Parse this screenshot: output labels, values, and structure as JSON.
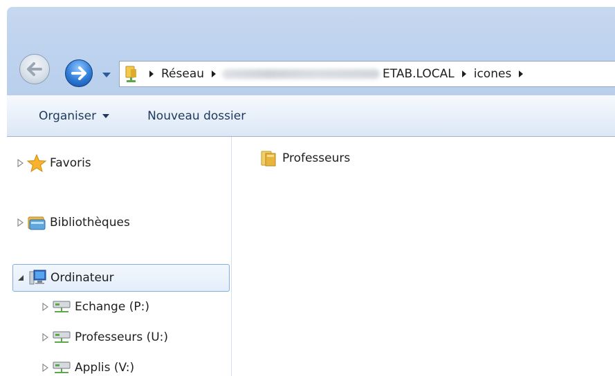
{
  "address_bar": {
    "crumbs": [
      "Réseau",
      "ETAB.LOCAL",
      "icones"
    ]
  },
  "command_bar": {
    "organise_label": "Organiser",
    "new_folder_label": "Nouveau dossier"
  },
  "navigation_pane": {
    "items": [
      {
        "label": "Favoris",
        "icon": "star-icon"
      },
      {
        "label": "Bibliothèques",
        "icon": "libraries-icon"
      },
      {
        "label": "Ordinateur",
        "icon": "computer-icon",
        "selected": true,
        "expanded": true
      },
      {
        "label": "Echange (P:)",
        "icon": "network-drive-icon"
      },
      {
        "label": "Professeurs (U:)",
        "icon": "network-drive-icon"
      },
      {
        "label": "Applis (V:)",
        "icon": "network-drive-icon"
      }
    ]
  },
  "content": {
    "items": [
      {
        "label": "Professeurs",
        "icon": "folder-icon"
      }
    ]
  },
  "colors": {
    "titlebar": "#bed3ee",
    "selection_border": "#84acdd",
    "command_text": "#1e395b"
  }
}
